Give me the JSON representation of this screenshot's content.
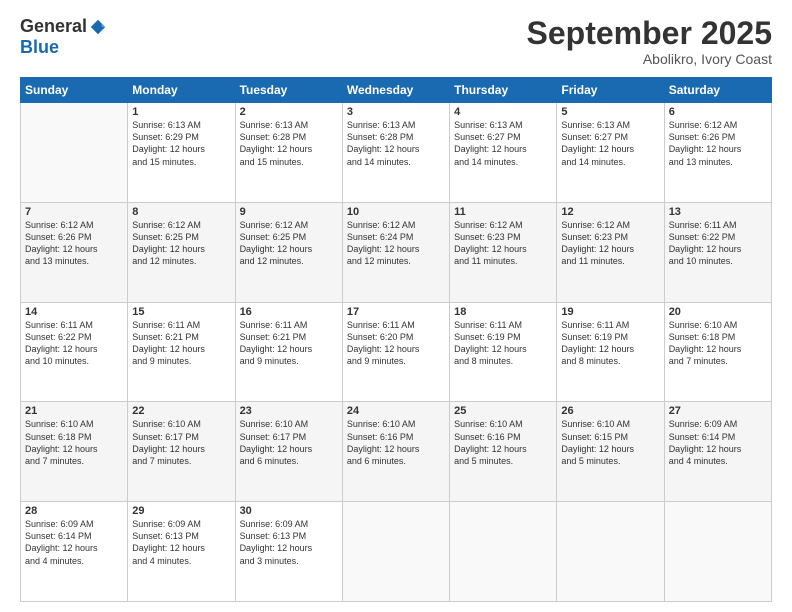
{
  "logo": {
    "general": "General",
    "blue": "Blue"
  },
  "header": {
    "month": "September 2025",
    "location": "Abolikro, Ivory Coast"
  },
  "weekdays": [
    "Sunday",
    "Monday",
    "Tuesday",
    "Wednesday",
    "Thursday",
    "Friday",
    "Saturday"
  ],
  "weeks": [
    [
      {
        "day": "",
        "info": ""
      },
      {
        "day": "1",
        "info": "Sunrise: 6:13 AM\nSunset: 6:29 PM\nDaylight: 12 hours\nand 15 minutes."
      },
      {
        "day": "2",
        "info": "Sunrise: 6:13 AM\nSunset: 6:28 PM\nDaylight: 12 hours\nand 15 minutes."
      },
      {
        "day": "3",
        "info": "Sunrise: 6:13 AM\nSunset: 6:28 PM\nDaylight: 12 hours\nand 14 minutes."
      },
      {
        "day": "4",
        "info": "Sunrise: 6:13 AM\nSunset: 6:27 PM\nDaylight: 12 hours\nand 14 minutes."
      },
      {
        "day": "5",
        "info": "Sunrise: 6:13 AM\nSunset: 6:27 PM\nDaylight: 12 hours\nand 14 minutes."
      },
      {
        "day": "6",
        "info": "Sunrise: 6:12 AM\nSunset: 6:26 PM\nDaylight: 12 hours\nand 13 minutes."
      }
    ],
    [
      {
        "day": "7",
        "info": "Sunrise: 6:12 AM\nSunset: 6:26 PM\nDaylight: 12 hours\nand 13 minutes."
      },
      {
        "day": "8",
        "info": "Sunrise: 6:12 AM\nSunset: 6:25 PM\nDaylight: 12 hours\nand 12 minutes."
      },
      {
        "day": "9",
        "info": "Sunrise: 6:12 AM\nSunset: 6:25 PM\nDaylight: 12 hours\nand 12 minutes."
      },
      {
        "day": "10",
        "info": "Sunrise: 6:12 AM\nSunset: 6:24 PM\nDaylight: 12 hours\nand 12 minutes."
      },
      {
        "day": "11",
        "info": "Sunrise: 6:12 AM\nSunset: 6:23 PM\nDaylight: 12 hours\nand 11 minutes."
      },
      {
        "day": "12",
        "info": "Sunrise: 6:12 AM\nSunset: 6:23 PM\nDaylight: 12 hours\nand 11 minutes."
      },
      {
        "day": "13",
        "info": "Sunrise: 6:11 AM\nSunset: 6:22 PM\nDaylight: 12 hours\nand 10 minutes."
      }
    ],
    [
      {
        "day": "14",
        "info": "Sunrise: 6:11 AM\nSunset: 6:22 PM\nDaylight: 12 hours\nand 10 minutes."
      },
      {
        "day": "15",
        "info": "Sunrise: 6:11 AM\nSunset: 6:21 PM\nDaylight: 12 hours\nand 9 minutes."
      },
      {
        "day": "16",
        "info": "Sunrise: 6:11 AM\nSunset: 6:21 PM\nDaylight: 12 hours\nand 9 minutes."
      },
      {
        "day": "17",
        "info": "Sunrise: 6:11 AM\nSunset: 6:20 PM\nDaylight: 12 hours\nand 9 minutes."
      },
      {
        "day": "18",
        "info": "Sunrise: 6:11 AM\nSunset: 6:19 PM\nDaylight: 12 hours\nand 8 minutes."
      },
      {
        "day": "19",
        "info": "Sunrise: 6:11 AM\nSunset: 6:19 PM\nDaylight: 12 hours\nand 8 minutes."
      },
      {
        "day": "20",
        "info": "Sunrise: 6:10 AM\nSunset: 6:18 PM\nDaylight: 12 hours\nand 7 minutes."
      }
    ],
    [
      {
        "day": "21",
        "info": "Sunrise: 6:10 AM\nSunset: 6:18 PM\nDaylight: 12 hours\nand 7 minutes."
      },
      {
        "day": "22",
        "info": "Sunrise: 6:10 AM\nSunset: 6:17 PM\nDaylight: 12 hours\nand 7 minutes."
      },
      {
        "day": "23",
        "info": "Sunrise: 6:10 AM\nSunset: 6:17 PM\nDaylight: 12 hours\nand 6 minutes."
      },
      {
        "day": "24",
        "info": "Sunrise: 6:10 AM\nSunset: 6:16 PM\nDaylight: 12 hours\nand 6 minutes."
      },
      {
        "day": "25",
        "info": "Sunrise: 6:10 AM\nSunset: 6:16 PM\nDaylight: 12 hours\nand 5 minutes."
      },
      {
        "day": "26",
        "info": "Sunrise: 6:10 AM\nSunset: 6:15 PM\nDaylight: 12 hours\nand 5 minutes."
      },
      {
        "day": "27",
        "info": "Sunrise: 6:09 AM\nSunset: 6:14 PM\nDaylight: 12 hours\nand 4 minutes."
      }
    ],
    [
      {
        "day": "28",
        "info": "Sunrise: 6:09 AM\nSunset: 6:14 PM\nDaylight: 12 hours\nand 4 minutes."
      },
      {
        "day": "29",
        "info": "Sunrise: 6:09 AM\nSunset: 6:13 PM\nDaylight: 12 hours\nand 4 minutes."
      },
      {
        "day": "30",
        "info": "Sunrise: 6:09 AM\nSunset: 6:13 PM\nDaylight: 12 hours\nand 3 minutes."
      },
      {
        "day": "",
        "info": ""
      },
      {
        "day": "",
        "info": ""
      },
      {
        "day": "",
        "info": ""
      },
      {
        "day": "",
        "info": ""
      }
    ]
  ]
}
